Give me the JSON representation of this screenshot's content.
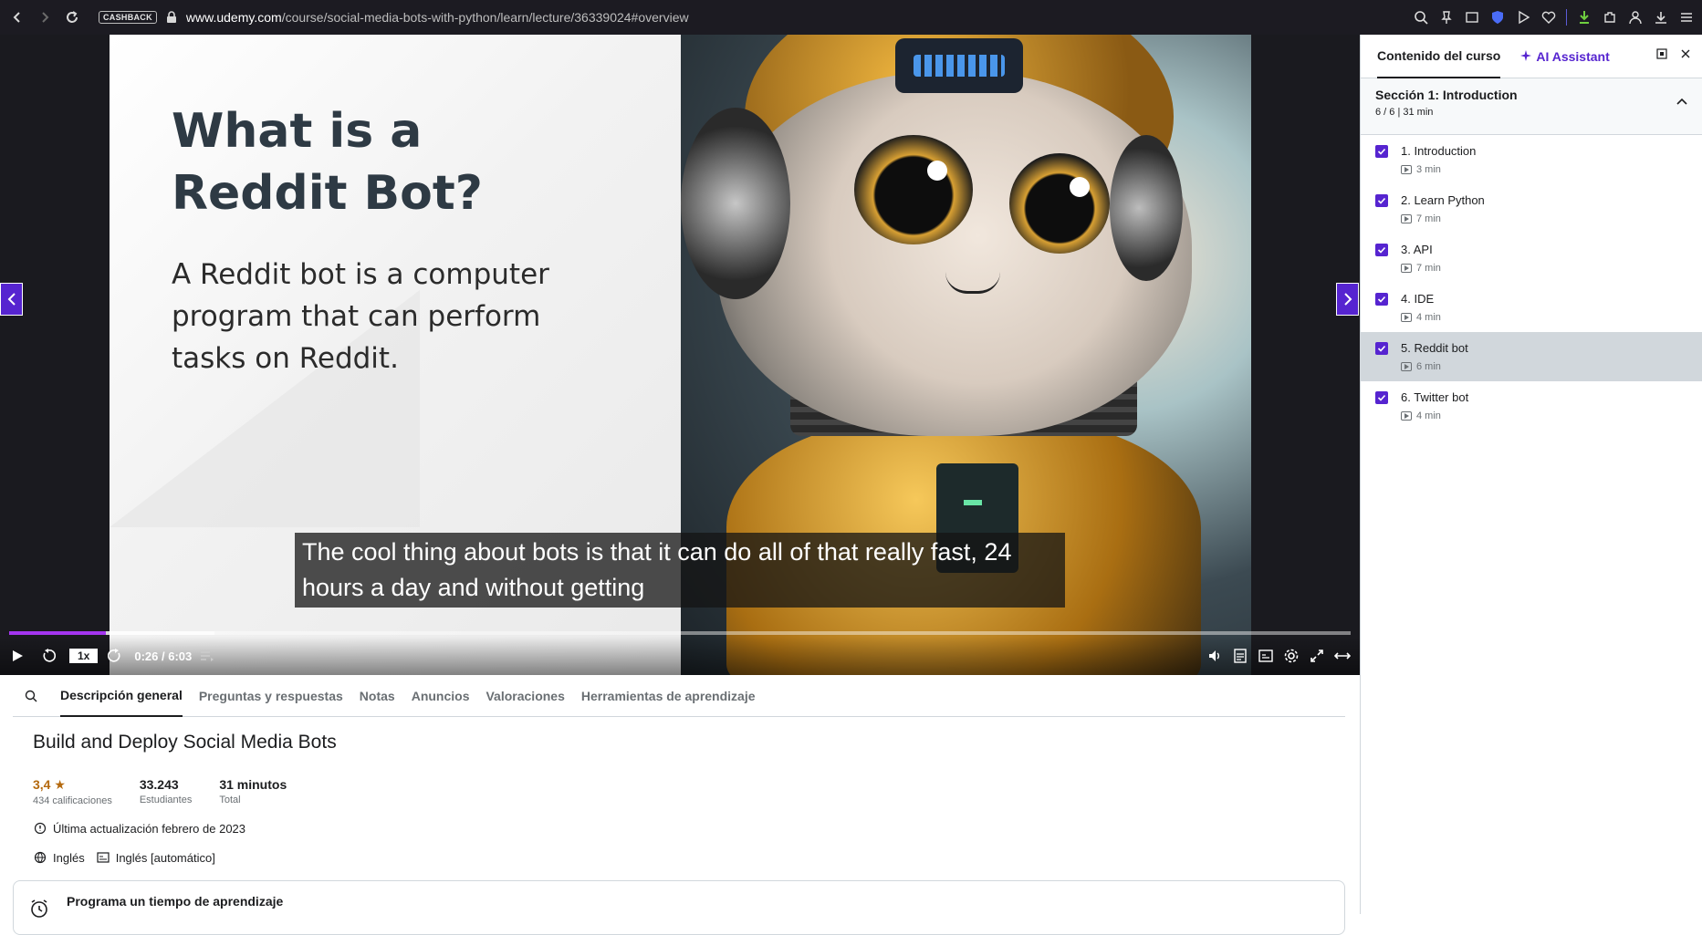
{
  "browser": {
    "cashback": "CASHBACK",
    "url_domain": "www.udemy.com",
    "url_path": "/course/social-media-bots-with-python/learn/lecture/36339024#overview"
  },
  "slide": {
    "title": "What is a Reddit Bot?",
    "body": "A Reddit bot is a computer program that can perform tasks on Reddit."
  },
  "player": {
    "caption": "The cool thing about bots is that it can do all of that really fast, 24 hours a day and without getting",
    "speed": "1x",
    "time": "0:26 / 6:03",
    "progress": 0.072,
    "buffered": 0.153
  },
  "tabs": [
    "Descripción general",
    "Preguntas y respuestas",
    "Notas",
    "Anuncios",
    "Valoraciones",
    "Herramientas de aprendizaje"
  ],
  "course": {
    "title": "Build and Deploy Social Media Bots",
    "rating": "3,4",
    "rating_label": "434 calificaciones",
    "students": "33.243",
    "students_label": "Estudiantes",
    "duration": "31 minutos",
    "duration_label": "Total",
    "updated": "Última actualización febrero de 2023",
    "language": "Inglés",
    "captions": "Inglés [automático]",
    "schedule": "Programa un tiempo de aprendizaje"
  },
  "sidebar": {
    "tab_content": "Contenido del curso",
    "tab_ai": "AI Assistant",
    "section_title": "Sección 1: Introduction",
    "section_meta": "6 / 6 | 31 min",
    "lectures": [
      {
        "title": "1. Introduction",
        "duration": "3 min"
      },
      {
        "title": "2. Learn Python",
        "duration": "7 min"
      },
      {
        "title": "3. API",
        "duration": "7 min"
      },
      {
        "title": "4. IDE",
        "duration": "4 min"
      },
      {
        "title": "5. Reddit bot",
        "duration": "6 min"
      },
      {
        "title": "6. Twitter bot",
        "duration": "4 min"
      }
    ]
  },
  "colors": {
    "accent": "#5624d0",
    "progress": "#a435f0",
    "rating": "#b4690e"
  }
}
